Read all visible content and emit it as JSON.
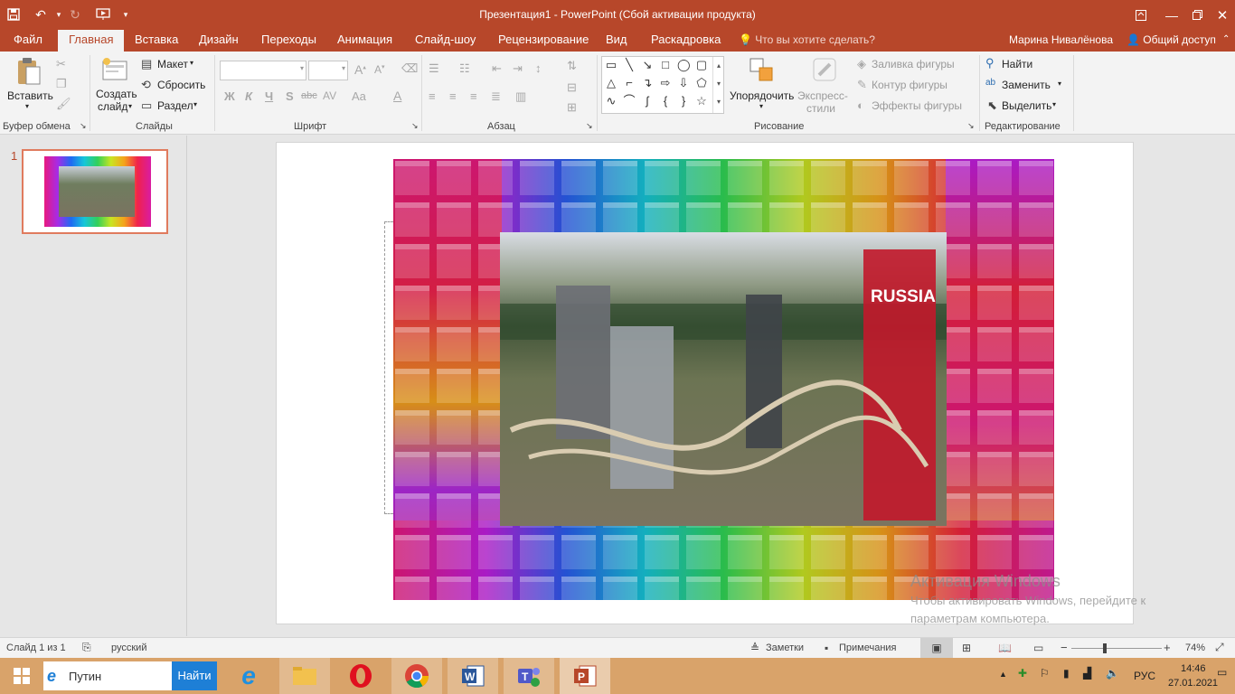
{
  "window": {
    "title": "Презентация1 - PowerPoint (Сбой активации продукта)",
    "user": "Марина Нивалёнова",
    "share": "Общий доступ",
    "tell_me": "Что вы хотите сделать?"
  },
  "tabs": [
    "Файл",
    "Главная",
    "Вставка",
    "Дизайн",
    "Переходы",
    "Анимация",
    "Слайд-шоу",
    "Рецензирование",
    "Вид",
    "Раскадровка"
  ],
  "ribbon": {
    "clipboard": {
      "paste": "Вставить",
      "label": "Буфер обмена"
    },
    "slides": {
      "new_slide_1": "Создать",
      "new_slide_2": "слайд",
      "layout": "Макет",
      "reset": "Сбросить",
      "section": "Раздел",
      "label": "Слайды"
    },
    "font": {
      "label": "Шрифт",
      "bold": "Ж",
      "italic": "К",
      "underline": "Ч",
      "shadow": "S",
      "strike": "abc",
      "spacing": "AV",
      "case": "Aa",
      "color": "A",
      "grow": "A",
      "shrink": "A"
    },
    "paragraph": {
      "label": "Абзац"
    },
    "drawing": {
      "arrange": "Упорядочить",
      "styles_1": "Экспресс-",
      "styles_2": "стили",
      "fill": "Заливка фигуры",
      "outline": "Контур фигуры",
      "effects": "Эффекты фигуры",
      "label": "Рисование"
    },
    "editing": {
      "find": "Найти",
      "replace": "Заменить",
      "select": "Выделить",
      "label": "Редактирование"
    }
  },
  "thumbnail": {
    "number": "1"
  },
  "slide": {
    "photo_text": "RUSSIA"
  },
  "watermark": {
    "title": "Активация Windows",
    "line1": "Чтобы активировать Windows, перейдите к",
    "line2": "параметрам компьютера."
  },
  "status": {
    "slide_info": "Слайд 1 из 1",
    "language": "русский",
    "notes": "Заметки",
    "comments": "Примечания",
    "zoom": "74%",
    "zoom_value": 0.74
  },
  "taskbar": {
    "search_placeholder": "Путин",
    "search_button": "Найти",
    "lang": "РУС",
    "time": "14:46",
    "date": "27.01.2021"
  },
  "colors": {
    "accent": "#b7472a",
    "taskbar": "#d9a36a",
    "search_button": "#1e7fd6"
  }
}
